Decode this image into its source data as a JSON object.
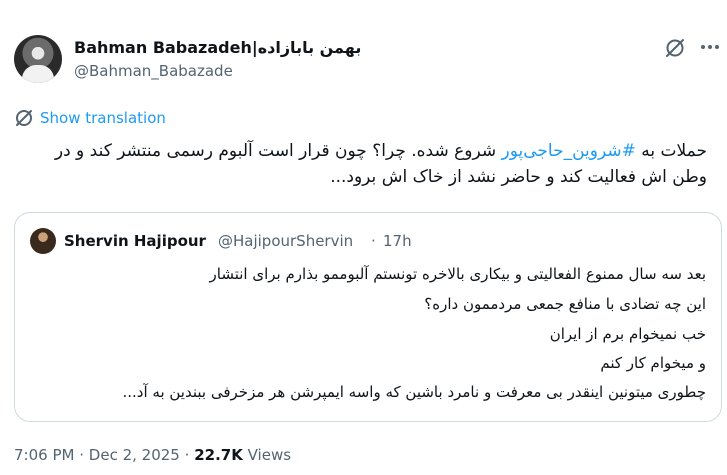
{
  "author": {
    "display_name": "Bahman Babazadeh|بهمن بابازاده",
    "handle": "@Bahman_Babazade"
  },
  "translation": {
    "label": "Show translation"
  },
  "tweet": {
    "text_before": "حملات به ",
    "hashtag": "#شروین_حاجی‌پور",
    "text_after": " شروع شده. چرا؟ چون قرار است آلبوم رسمی منتشر کند و در وطن اش فعالیت کند و حاضر نشد از خاک اش برود..."
  },
  "quoted": {
    "display_name": "Shervin Hajipour",
    "handle": "@HajipourShervin",
    "separator": "·",
    "time": "17h",
    "lines": [
      "بعد سه سال ممنوع الفعالیتی و بیکاری بالاخره تونستم آلبوممو بذارم برای انتشار",
      "این چه تضادی با منافع جمعی مردممون داره؟",
      "خب نمیخوام برم از ایران",
      "و میخوام کار کنم",
      "چطوری میتونین اینقدر بی معرفت و نامرد باشین که واسه ایمپرشن هر مزخرفی ببندین به آد..."
    ]
  },
  "meta": {
    "time": "7:06 PM",
    "separator": "·",
    "date": "Dec 2, 2025",
    "views_count": "22.7K",
    "views_label": "Views"
  },
  "icons": [
    "grok-icon",
    "more-icon",
    "translate-icon"
  ],
  "colors": {
    "link": "#1d9bf0",
    "secondary_text": "#536471",
    "primary_text": "#0f1419",
    "border": "#cfd9de"
  }
}
